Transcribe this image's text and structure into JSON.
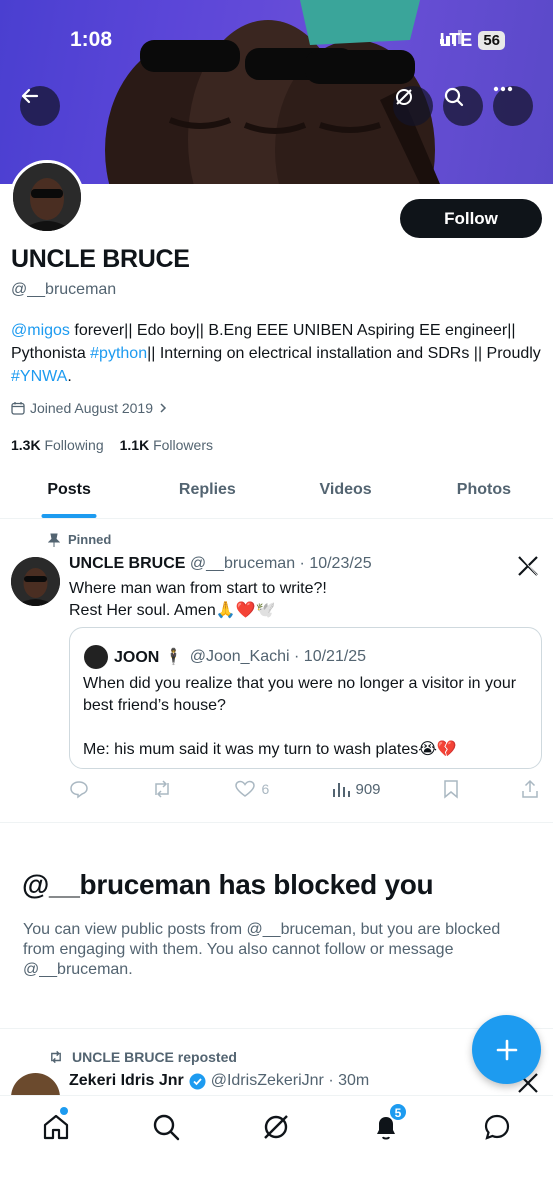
{
  "status_bar": {
    "time": "1:08",
    "network": "LTE",
    "battery": "56"
  },
  "profile": {
    "display_name": "UNCLE BRUCE",
    "handle": "@__bruceman",
    "follow_label": "Follow",
    "bio": {
      "mention": "@migos",
      "part1": " forever|| Edo boy|| B.Eng EEE UNIBEN Aspiring EE engineer|| Pythonista ",
      "hashtag1": "#python",
      "part2": "|| Interning on electrical installation and SDRs || Proudly ",
      "hashtag2": "#YNWA",
      "part3": "."
    },
    "joined": "Joined August 2019",
    "following_count": "1.3K",
    "following_label": "Following",
    "followers_count": "1.1K",
    "followers_label": "Followers"
  },
  "tabs": [
    {
      "label": "Posts",
      "active": true
    },
    {
      "label": "Replies"
    },
    {
      "label": "Videos"
    },
    {
      "label": "Photos"
    }
  ],
  "pinned_post": {
    "pinned_label": "Pinned",
    "author": "UNCLE BRUCE",
    "meta": "@__bruceman · 10/23/25",
    "line1": "Where man wan from start to write?!",
    "line2": "Rest Her soul. Amen🙏❤️🕊️",
    "quote": {
      "author": "JOON 🕴",
      "meta": "@Joon_Kachi · 10/21/25",
      "line1": "When did you realize that you were no longer a visitor in your best friend’s house?",
      "line2": "Me: his mum said it was my turn to wash plates😭💔"
    },
    "likes": "6",
    "views": "909"
  },
  "blocked": {
    "title": "@__bruceman has blocked you",
    "text": "You can view public posts from @__bruceman, but you are blocked from engaging with them. You also cannot follow or message @__bruceman."
  },
  "repost": {
    "label": "UNCLE BRUCE reposted",
    "author": "Zekeri Idris Jnr",
    "meta": "@IdrisZekeriJnr · 30m"
  },
  "nav": {
    "notifications_badge": "5"
  },
  "colors": {
    "accent": "#1d9bf0",
    "text": "#0f1419",
    "muted": "#536471",
    "banner": "#5b46d8"
  }
}
